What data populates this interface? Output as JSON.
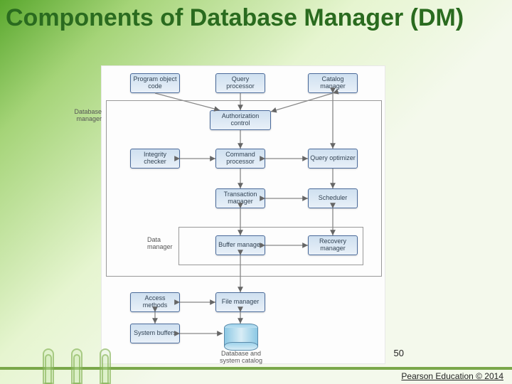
{
  "title": "Components of Database Manager (DM)",
  "page_number": "50",
  "credit": "Pearson Education © 2014",
  "labels": {
    "database_manager": "Database\nmanager",
    "data_manager": "Data\nmanager"
  },
  "nodes": {
    "program_object_code": "Program\nobject code",
    "query_processor": "Query\nprocessor",
    "catalog_manager": "Catalog\nmanager",
    "authorization_control": "Authorization\ncontrol",
    "integrity_checker": "Integrity\nchecker",
    "command_processor": "Command\nprocessor",
    "query_optimizer": "Query\noptimizer",
    "transaction_manager": "Transaction\nmanager",
    "scheduler": "Scheduler",
    "buffer_manager": "Buffer\nmanager",
    "recovery_manager": "Recovery\nmanager",
    "access_methods": "Access\nmethods",
    "file_manager": "File\nmanager",
    "system_buffers": "System\nbuffers"
  },
  "db_label": "Database\nand\nsystem catalog"
}
